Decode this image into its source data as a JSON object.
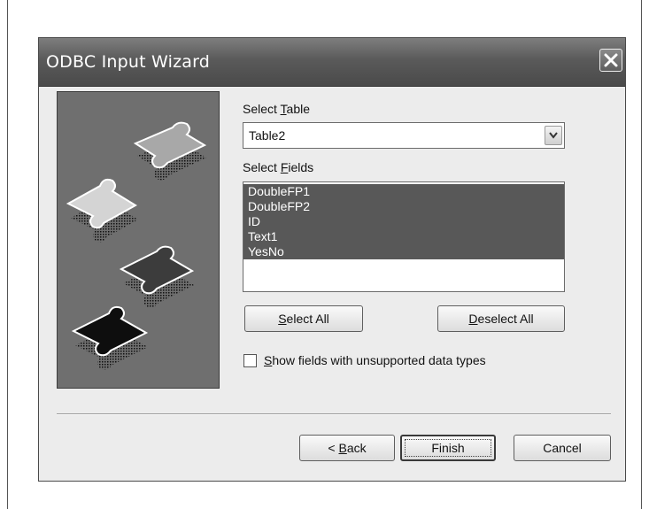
{
  "dialog": {
    "title": "ODBC Input Wizard",
    "close_glyph": "close-icon"
  },
  "select_table": {
    "label_prefix": "Select ",
    "label_accel": "T",
    "label_rest": "able",
    "value": "Table2"
  },
  "select_fields": {
    "label_prefix": "Select ",
    "label_accel": "F",
    "label_rest": "ields",
    "items": [
      "DoubleFP1",
      "DoubleFP2",
      "ID",
      "Text1",
      "YesNo"
    ]
  },
  "buttons": {
    "select_all_accel": "S",
    "select_all_rest": "elect All",
    "deselect_all_accel": "D",
    "deselect_all_rest": "eselect All",
    "back_prefix": "< ",
    "back_accel": "B",
    "back_rest": "ack",
    "finish": "Finish",
    "cancel": "Cancel"
  },
  "unsupported_checkbox": {
    "label_accel": "S",
    "label_rest": "how fields with unsupported data types",
    "checked": false
  },
  "colors": {
    "title_bar": "#5a5a5a",
    "selection": "#585858",
    "picture_bg": "#6f6f6f"
  }
}
